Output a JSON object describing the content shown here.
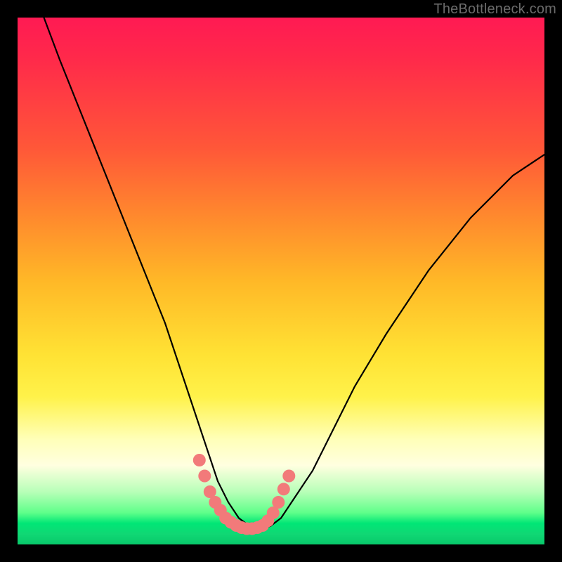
{
  "watermark": "TheBottleneck.com",
  "colors": {
    "curve": "#000000",
    "marker": "#f27a7a",
    "gradient_top": "#ff1a53",
    "gradient_bottom": "#08c86a"
  },
  "chart_data": {
    "type": "line",
    "title": "",
    "xlabel": "",
    "ylabel": "",
    "xlim": [
      0,
      100
    ],
    "ylim": [
      0,
      100
    ],
    "note": "no numeric axis ticks shown; values are percent of plot area estimated from pixels",
    "series": [
      {
        "name": "bottleneck-curve",
        "x": [
          5,
          8,
          12,
          16,
          20,
          24,
          28,
          30,
          32,
          34,
          36,
          38,
          40,
          42,
          44,
          46,
          48,
          50,
          52,
          56,
          60,
          64,
          70,
          78,
          86,
          94,
          100
        ],
        "y": [
          100,
          92,
          82,
          72,
          62,
          52,
          42,
          36,
          30,
          24,
          18,
          12,
          8,
          5,
          3.5,
          3,
          3.5,
          5,
          8,
          14,
          22,
          30,
          40,
          52,
          62,
          70,
          74
        ]
      }
    ],
    "markers": {
      "name": "valley-highlight",
      "x": [
        34.5,
        35.5,
        36.5,
        37.5,
        38.5,
        39.5,
        40.5,
        41.5,
        42.5,
        43.5,
        44.5,
        45.5,
        46.5,
        47.5,
        48.5,
        49.5,
        50.5,
        51.5
      ],
      "y": [
        16,
        13,
        10,
        8,
        6.5,
        5,
        4.2,
        3.6,
        3.2,
        3,
        3,
        3.2,
        3.6,
        4.5,
        6,
        8,
        10.5,
        13
      ]
    }
  }
}
